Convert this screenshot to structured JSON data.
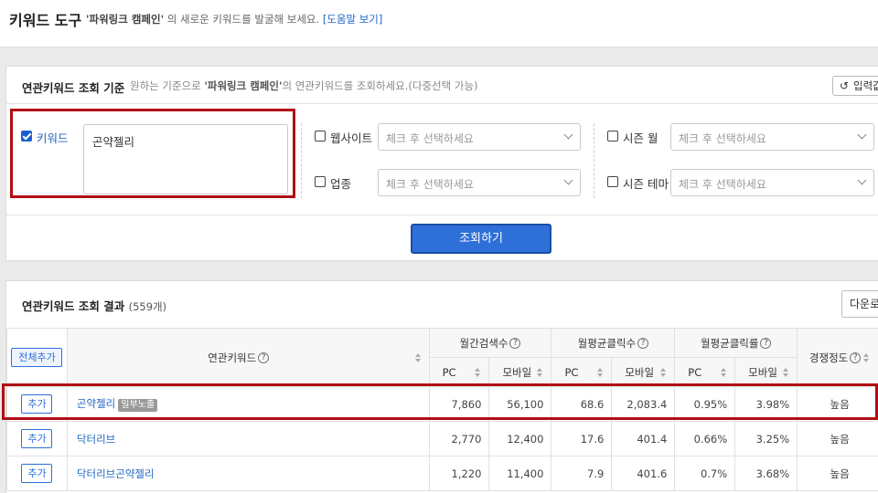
{
  "header": {
    "title": "키워드 도구",
    "subtitle_campaign": "'파워링크 캠페인'",
    "subtitle_text": " 의 새로운 키워드를 발굴해 보세요.",
    "help_link": "[도움말 보기]"
  },
  "criteria": {
    "title": "연관키워드 조회 기준",
    "desc_prefix": "원하는 기준으로 ",
    "desc_campaign": "'파워링크 캠페인'",
    "desc_suffix": "의 연관키워드를 조회하세요.(다중선택 가능)",
    "reset_label": "입력값",
    "keyword_label": "키워드",
    "keyword_value": "곤약젤리",
    "website_label": "웹사이트",
    "business_label": "업종",
    "season_month_label": "시즌 월",
    "season_theme_label": "시즌 테마",
    "select_placeholder": "체크 후 선택하세요",
    "search_button": "조회하기"
  },
  "results": {
    "title": "연관키워드 조회 결과",
    "count": "(559개)",
    "download_label": "다운로드",
    "add_all": "전체추가",
    "columns": {
      "keyword": "연관키워드",
      "monthly_search": "월간검색수",
      "avg_clicks": "월평균클릭수",
      "avg_ctr": "월평균클릭률",
      "competition": "경쟁정도",
      "pc": "PC",
      "mobile": "모바일"
    },
    "add_label": "추가",
    "rows": [
      {
        "keyword": "곤약젤리",
        "tag": "일부노출",
        "search_pc": "7,860",
        "search_mobile": "56,100",
        "clicks_pc": "68.6",
        "clicks_mobile": "2,083.4",
        "ctr_pc": "0.95%",
        "ctr_mobile": "3.98%",
        "competition": "높음"
      },
      {
        "keyword": "닥터리브",
        "tag": "",
        "search_pc": "2,770",
        "search_mobile": "12,400",
        "clicks_pc": "17.6",
        "clicks_mobile": "401.4",
        "ctr_pc": "0.66%",
        "ctr_mobile": "3.25%",
        "competition": "높음"
      },
      {
        "keyword": "닥터리브곤약젤리",
        "tag": "",
        "search_pc": "1,220",
        "search_mobile": "11,400",
        "clicks_pc": "7.9",
        "clicks_mobile": "401.6",
        "ctr_pc": "0.7%",
        "ctr_mobile": "3.68%",
        "competition": "높음"
      }
    ]
  },
  "colors": {
    "accent": "#2e6fd8",
    "link": "#1f67c4",
    "highlight": "#b00f14"
  }
}
